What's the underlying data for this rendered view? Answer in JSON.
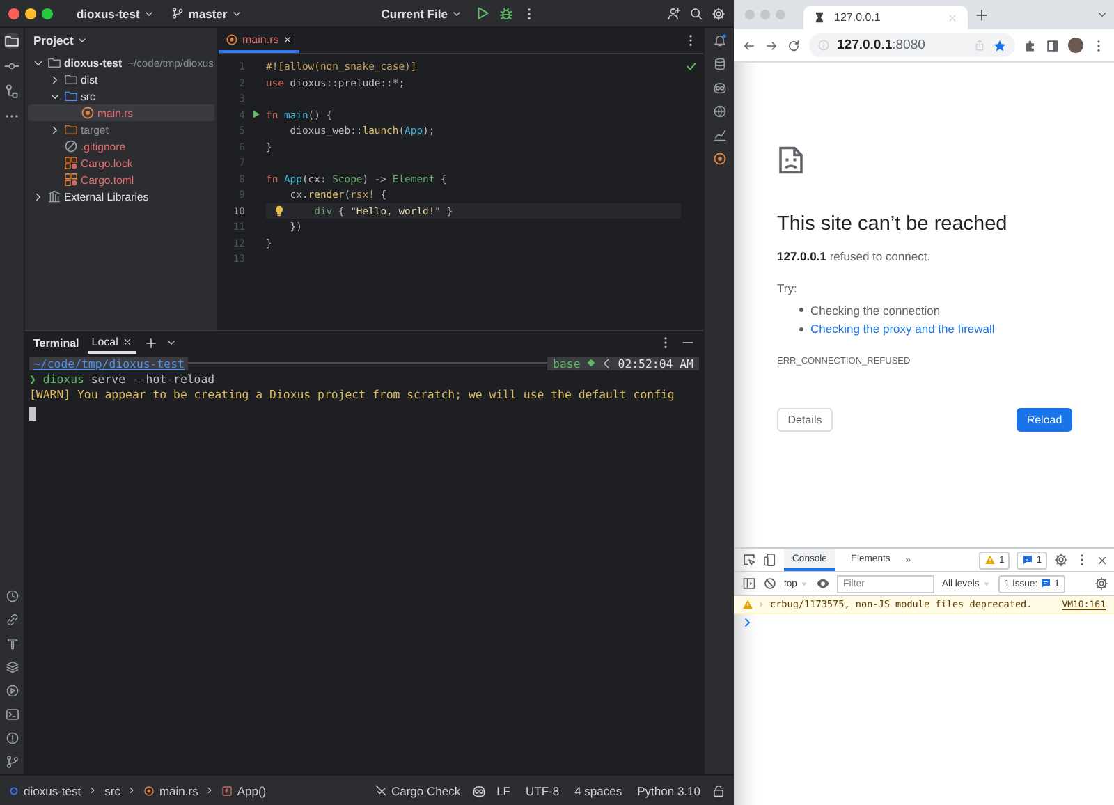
{
  "ide": {
    "title_bar": {
      "project": "dioxus-test",
      "branch": "master",
      "run_config": "Current File"
    },
    "project_panel": {
      "title": "Project",
      "tree": [
        {
          "name": "dioxus-test",
          "path": "~/code/tmp/dioxus",
          "kind": "folder",
          "untracked": false,
          "excluded": false,
          "expanded": true,
          "selected": false,
          "children": [
            {
              "name": "dist",
              "kind": "folder",
              "untracked": false,
              "excluded": false,
              "expanded": false,
              "selected": false
            },
            {
              "name": "src",
              "kind": "source_folder",
              "untracked": false,
              "excluded": false,
              "expanded": true,
              "selected": false,
              "children": [
                {
                  "name": "main.rs",
                  "kind": "rust",
                  "untracked": true,
                  "excluded": false,
                  "selected": true
                }
              ]
            },
            {
              "name": "target",
              "kind": "folder",
              "untracked": false,
              "excluded": true,
              "expanded": false,
              "selected": false
            },
            {
              "name": ".gitignore",
              "kind": "ignore",
              "untracked": true,
              "excluded": false,
              "selected": false
            },
            {
              "name": "Cargo.lock",
              "kind": "cargo",
              "untracked": true,
              "excluded": false,
              "selected": false
            },
            {
              "name": "Cargo.toml",
              "kind": "cargo",
              "untracked": true,
              "excluded": false,
              "selected": false
            }
          ]
        },
        {
          "name": "External Libraries",
          "kind": "libraries",
          "untracked": false,
          "excluded": false,
          "expanded": false,
          "selected": false
        }
      ]
    },
    "editor": {
      "tabs": [
        {
          "label": "main.rs",
          "untracked": true,
          "selected": true
        }
      ],
      "lines": [
        {
          "number": "1",
          "kind": "plain",
          "current": false,
          "tokens": [
            {
              "t": "#![allow(non_snake_case)]",
              "kind": "attr"
            }
          ]
        },
        {
          "number": "2",
          "kind": "plain",
          "current": false,
          "tokens": [
            {
              "t": "use",
              "kind": "kw"
            },
            {
              "t": " dioxus::prelude::*;",
              "kind": "plain"
            }
          ]
        },
        {
          "number": "3",
          "kind": "plain",
          "current": false
        },
        {
          "number": "4",
          "kind": "run",
          "current": false,
          "tokens": [
            {
              "t": "fn ",
              "kind": "kw"
            },
            {
              "t": "main",
              "kind": "fndef"
            },
            {
              "t": "() {",
              "kind": "plain"
            }
          ]
        },
        {
          "number": "5",
          "kind": "plain",
          "current": false,
          "tokens": [
            {
              "t": "    dioxus_web::",
              "kind": "plain"
            },
            {
              "t": "launch",
              "kind": "call"
            },
            {
              "t": "(",
              "kind": "plain"
            },
            {
              "t": "App",
              "kind": "fndef"
            },
            {
              "t": ");",
              "kind": "plain"
            }
          ]
        },
        {
          "number": "6",
          "kind": "plain",
          "current": false,
          "tokens": [
            {
              "t": "}",
              "kind": "plain"
            }
          ]
        },
        {
          "number": "7",
          "kind": "plain",
          "current": false
        },
        {
          "number": "8",
          "kind": "plain",
          "current": false,
          "tokens": [
            {
              "t": "fn ",
              "kind": "kw"
            },
            {
              "t": "App",
              "kind": "fndef"
            },
            {
              "t": "(cx: ",
              "kind": "plain"
            },
            {
              "t": "Scope",
              "kind": "type"
            },
            {
              "t": ") -> ",
              "kind": "plain"
            },
            {
              "t": "Element",
              "kind": "type"
            },
            {
              "t": " {",
              "kind": "plain"
            }
          ]
        },
        {
          "number": "9",
          "kind": "plain",
          "current": false,
          "tokens": [
            {
              "t": "    cx.",
              "kind": "plain"
            },
            {
              "t": "render",
              "kind": "call"
            },
            {
              "t": "(",
              "kind": "plain"
            },
            {
              "t": "rsx!",
              "kind": "macro"
            },
            {
              "t": " {",
              "kind": "plain"
            }
          ]
        },
        {
          "number": "10",
          "kind": "bulb",
          "current": true,
          "tokens": [
            {
              "t": "        div",
              "kind": "type"
            },
            {
              "t": " { ",
              "kind": "plain"
            },
            {
              "t": "\"Hello, world!\"",
              "kind": "string"
            },
            {
              "t": " }",
              "kind": "plain"
            }
          ]
        },
        {
          "number": "11",
          "kind": "plain",
          "current": false,
          "tokens": [
            {
              "t": "    })",
              "kind": "plain"
            }
          ]
        },
        {
          "number": "12",
          "kind": "plain",
          "current": false,
          "tokens": [
            {
              "t": "}",
              "kind": "plain"
            }
          ]
        },
        {
          "number": "13",
          "kind": "plain",
          "current": false
        }
      ]
    },
    "terminal": {
      "title": "Terminal",
      "tabs": [
        {
          "label": "Local",
          "selected": true
        }
      ],
      "prompt": {
        "path": "~/code/tmp/dioxus-test",
        "env": "base",
        "time": "02:52:04 AM"
      },
      "lines": [
        {
          "tokens": [
            {
              "t": "❯ ",
              "kind": "prompt"
            },
            {
              "t": "dioxus",
              "kind": "command"
            },
            {
              "t": " serve --hot-reload",
              "kind": "plain"
            }
          ]
        },
        {
          "tokens": [
            {
              "t": "[WARN] You appear to be creating a Dioxus project from scratch; we will use the default config",
              "kind": "warn"
            }
          ]
        }
      ]
    },
    "status_bar": {
      "breadcrumbs": [
        {
          "label": "dioxus-test",
          "kind": "project"
        },
        {
          "label": "src",
          "kind": "folder"
        },
        {
          "label": "main.rs",
          "kind": "rust"
        },
        {
          "label": "App()",
          "kind": "function"
        }
      ],
      "widgets": [
        {
          "kind": "cargo_check",
          "label": "Cargo Check"
        },
        {
          "kind": "assistant"
        },
        {
          "kind": "text",
          "label": "LF"
        },
        {
          "kind": "text",
          "label": "UTF-8"
        },
        {
          "kind": "text",
          "label": "4 spaces"
        },
        {
          "kind": "text",
          "label": "Python 3.10"
        },
        {
          "kind": "lock"
        }
      ]
    }
  },
  "browser": {
    "tabs": [
      {
        "title": "127.0.0.1",
        "selected": true
      }
    ],
    "address": "**127.0.0.1**:8080",
    "bookmarked": true,
    "error_page": {
      "title": "This site can’t be reached",
      "message": "**127.0.0.1** refused to connect.",
      "try_label": "Try:",
      "suggestions": [
        {
          "text": "Checking the connection",
          "kind": "text"
        },
        {
          "text": "Checking the proxy and the firewall",
          "kind": "link"
        }
      ],
      "code": "ERR_CONNECTION_REFUSED",
      "buttons": [
        {
          "label": "Details",
          "kind": "secondary"
        },
        {
          "label": "Reload",
          "kind": "primary"
        }
      ]
    },
    "devtools": {
      "tabs": [
        {
          "label": "Console",
          "selected": true
        },
        {
          "label": "Elements",
          "selected": false
        }
      ],
      "more": "»",
      "warning_count": "1",
      "message_count": "1",
      "context": "top",
      "filter_placeholder": "Filter",
      "levels": "All levels",
      "issues_label": "1 Issue:",
      "issues_count": "1",
      "messages": [
        {
          "kind": "warning",
          "text": "crbug/1173575, non-JS module files deprecated.",
          "source": "VM10:161"
        }
      ]
    }
  }
}
